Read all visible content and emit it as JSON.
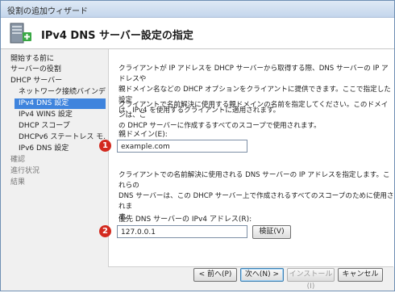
{
  "window": {
    "title": "役割の追加ウィザード"
  },
  "header": {
    "title": "IPv4 DNS サーバー設定の指定"
  },
  "sidebar": {
    "items": [
      {
        "label": "開始する前に",
        "state": "normal"
      },
      {
        "label": "サーバーの役割",
        "state": "normal"
      },
      {
        "label": "DHCP サーバー",
        "state": "normal"
      },
      {
        "label": "ネットワーク接続バインデ…",
        "state": "normal"
      },
      {
        "label": "IPv4 DNS 設定",
        "state": "selected"
      },
      {
        "label": "IPv4 WINS 設定",
        "state": "normal"
      },
      {
        "label": "DHCP スコープ",
        "state": "normal"
      },
      {
        "label": "DHCPv6 ステートレス モ…",
        "state": "normal"
      },
      {
        "label": "IPv6 DNS 設定",
        "state": "normal"
      },
      {
        "label": "確認",
        "state": "disabled"
      },
      {
        "label": "進行状況",
        "state": "disabled"
      },
      {
        "label": "結果",
        "state": "disabled"
      }
    ]
  },
  "main": {
    "intro": [
      "クライアントが IP アドレスを DHCP サーバーから取得する際、DNS サーバーの IP アドレスや",
      "親ドメイン名などの DHCP オプションをクライアントに提供できます。ここで指定した設定",
      "は、IPv4 を使用するクライアントに適用されます。"
    ],
    "domain_desc": [
      "クライアントで名前解決に使用する親ドメインの名前を指定してください。このドメインは、こ",
      "の DHCP サーバーに作成するすべてのスコープで使用されます。"
    ],
    "domain_label": "親ドメイン(E):",
    "domain_value": "example.com",
    "dns_desc": [
      "クライアントでの名前解決に使用される DNS サーバーの IP アドレスを指定します。これらの",
      "DNS サーバーは、この DHCP サーバー上で作成されるすべてのスコープのために使用されま",
      "す。"
    ],
    "dns_label": "優先 DNS サーバーの IPv4 アドレス(R):",
    "dns_value": "127.0.0.1",
    "validate_button": "検証(V)"
  },
  "annotations": {
    "marker1": "1",
    "marker2": "2"
  },
  "footer": {
    "back_button": "< 前へ(P)",
    "next_button": "次へ(N) >",
    "install_button": "インストール(I)",
    "cancel_button": "キャンセル"
  },
  "colors": {
    "selection": "#3f84dd",
    "marker": "#d32a1f",
    "titlebar": "#c4d6ec"
  }
}
